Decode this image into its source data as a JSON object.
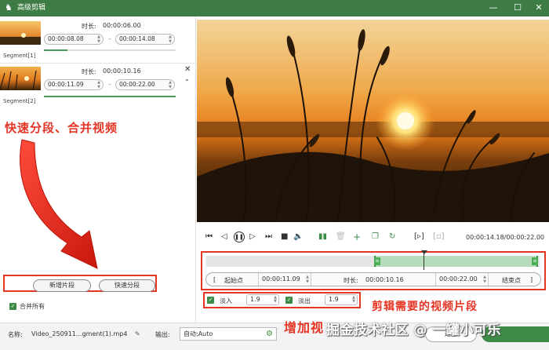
{
  "window": {
    "title": "高级剪辑",
    "minimize": "—",
    "maximize": "☐",
    "close": "✕"
  },
  "segments": [
    {
      "label": "Segment[1]",
      "duration_label": "时长:",
      "duration": "00:00:06.00",
      "start": "00:00:08.08",
      "end": "00:00:14.08"
    },
    {
      "label": "Segment[2]",
      "duration_label": "时长:",
      "duration": "00:00:10.16",
      "start": "00:00:11.09",
      "end": "00:00:22.00"
    }
  ],
  "segment_close": "✕",
  "annotations": {
    "left": "快速分段、合并视频",
    "right": "剪辑需要的视频片段",
    "bottom": "增加视"
  },
  "watermark": "掘金技术社区 @ 一罐小可乐",
  "buttons": {
    "new_segment": "新增片段",
    "quick_split": "快速分段"
  },
  "merge_all": {
    "label": "合并所有",
    "checked": true
  },
  "player": {
    "time": "00:00:14.18/00:00:22.00"
  },
  "trim": {
    "start_bracket": "[",
    "start_label": "起始点",
    "start_value": "00:00:11.09",
    "duration_label": "时长:",
    "duration_value": "00:00:10.16",
    "end_value": "00:00:22.00",
    "end_label": "结束点",
    "end_bracket": "]"
  },
  "fade": {
    "in_label": "淡入",
    "in_value": "1.9",
    "out_label": "淡出",
    "out_value": "1.9"
  },
  "bottom": {
    "name_label": "名称:",
    "name_value": "Video_250911...gment(1).mp4",
    "output_label": "输出:",
    "output_value": "自动;Auto",
    "return_label": "返回"
  },
  "colors": {
    "accent": "#3e8b47",
    "titlebar": "#3e7c45",
    "annotation": "#e53524"
  }
}
